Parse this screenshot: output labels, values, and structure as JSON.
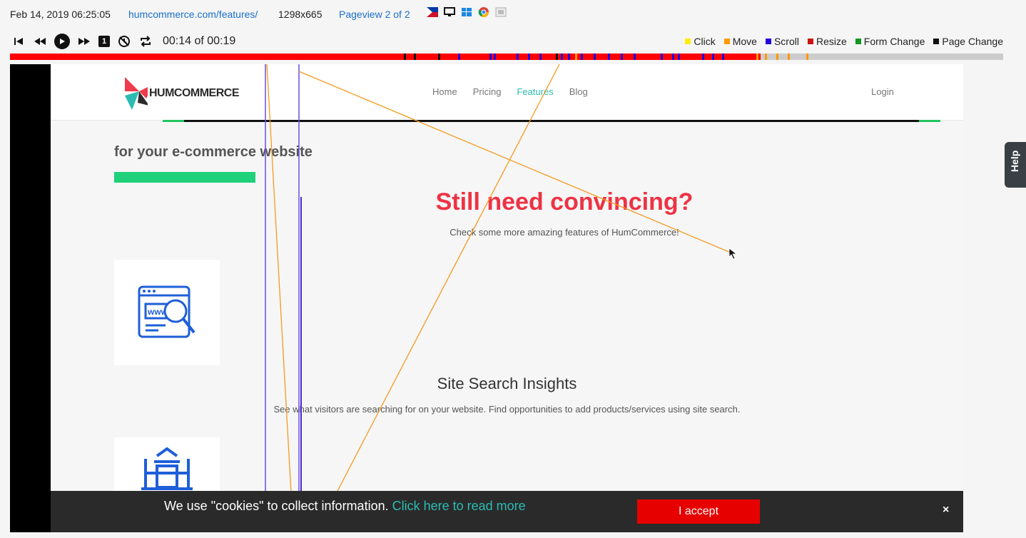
{
  "session": {
    "datetime": "Feb 14, 2019 06:25:05",
    "url": "humcommerce.com/features/",
    "resolution": "1298x665",
    "pageview": "Pageview 2 of 2"
  },
  "player": {
    "one_label": "1",
    "time": "00:14 of 00:19",
    "progress": 0.756
  },
  "legend": [
    {
      "label": "Click",
      "color": "#ffee00"
    },
    {
      "label": "Move",
      "color": "#ff9900"
    },
    {
      "label": "Scroll",
      "color": "#2200dd"
    },
    {
      "label": "Resize",
      "color": "#cc1111"
    },
    {
      "label": "Form Change",
      "color": "#119922"
    },
    {
      "label": "Page Change",
      "color": "#111111"
    }
  ],
  "site": {
    "logo_text": "HUMCOMMERCE",
    "nav": [
      "Home",
      "Pricing",
      "Features",
      "Blog"
    ],
    "login": "Login",
    "tagline": "for your e-commerce website",
    "headline": "Still need convincing?",
    "subhead": "Check some more amazing features of HumCommerce!",
    "feature_title": "Site Search Insights",
    "feature_text": "See what visitors are searching for on your website. Find opportunities to add products/services using site search."
  },
  "cookie": {
    "text": "We use \"cookies\" to collect information.",
    "link": "Click here to read more",
    "accept": "I accept",
    "close": "×"
  },
  "help_label": "Help"
}
